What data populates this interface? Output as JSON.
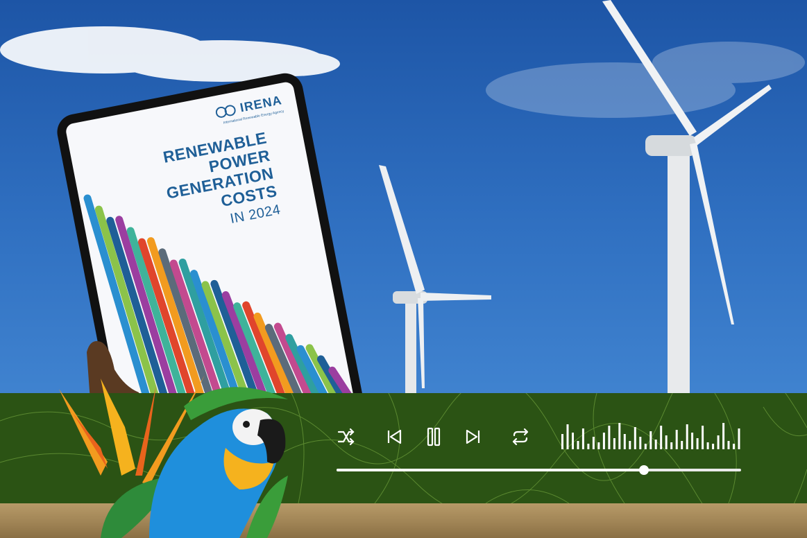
{
  "report": {
    "publisher": "IRENA",
    "publisher_full": "International Renewable Energy Agency",
    "title_lines": [
      "RENEWABLE",
      "POWER",
      "GENERATION",
      "COSTS"
    ],
    "subtitle": "IN 2024"
  },
  "player": {
    "controls": [
      {
        "id": "shuffle",
        "icon": "shuffle-icon"
      },
      {
        "id": "previous",
        "icon": "skip-back-icon"
      },
      {
        "id": "pause",
        "icon": "pause-icon"
      },
      {
        "id": "next",
        "icon": "skip-forward-icon"
      },
      {
        "id": "repeat",
        "icon": "repeat-icon"
      }
    ],
    "progress": 0.76,
    "waveform_levels": [
      0.55,
      0.9,
      0.6,
      0.3,
      0.75,
      0.2,
      0.45,
      0.25,
      0.6,
      0.85,
      0.4,
      0.95,
      0.55,
      0.3,
      0.8,
      0.45,
      0.2,
      0.65,
      0.35,
      0.85,
      0.5,
      0.25,
      0.7,
      0.3,
      0.9,
      0.6,
      0.4,
      0.85,
      0.25,
      0.2,
      0.5,
      0.95,
      0.3,
      0.2,
      0.75
    ],
    "colors": {
      "bar": "#2b5314",
      "accent": "#ffffff",
      "line_art": "#6b9b3a"
    }
  },
  "scene": {
    "sky": "#2f6fc0",
    "ground": "#a08455",
    "chart_stripe_colors": [
      "#2a8fd0",
      "#8bc34a",
      "#1f5f97",
      "#9b3ea0",
      "#3fb39a",
      "#e0452c",
      "#f29b1f",
      "#5b6b7a",
      "#c34a8f",
      "#2f9fa0"
    ]
  }
}
